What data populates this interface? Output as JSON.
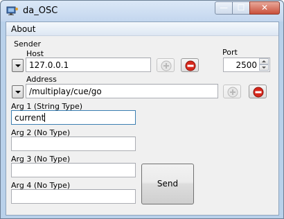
{
  "window": {
    "title": "da_OSC",
    "minimize_glyph": "—",
    "maximize_glyph": "☐",
    "close_glyph": "✕"
  },
  "menu": {
    "items": [
      {
        "label": "About"
      }
    ]
  },
  "sender": {
    "group_label": "Sender",
    "host_label": "Host",
    "host_value": "127.0.0.1",
    "port_label": "Port",
    "port_value": "2500",
    "address_label": "Address",
    "address_value": "/multiplay/cue/go"
  },
  "args": [
    {
      "label": "Arg 1 (String Type)",
      "value": "current"
    },
    {
      "label": "Arg 2 (No Type)",
      "value": ""
    },
    {
      "label": "Arg 3 (No Type)",
      "value": ""
    },
    {
      "label": "Arg 4 (No Type)",
      "value": ""
    }
  ],
  "send_label": "Send",
  "icons": {
    "add": "add-icon",
    "remove": "remove-icon",
    "dropdown": "chevron-down-icon",
    "app": "app-icon"
  },
  "colors": {
    "remove_red": "#d8281c",
    "add_gray": "#b8b8b8",
    "title_bar": "#c3d6ee"
  }
}
